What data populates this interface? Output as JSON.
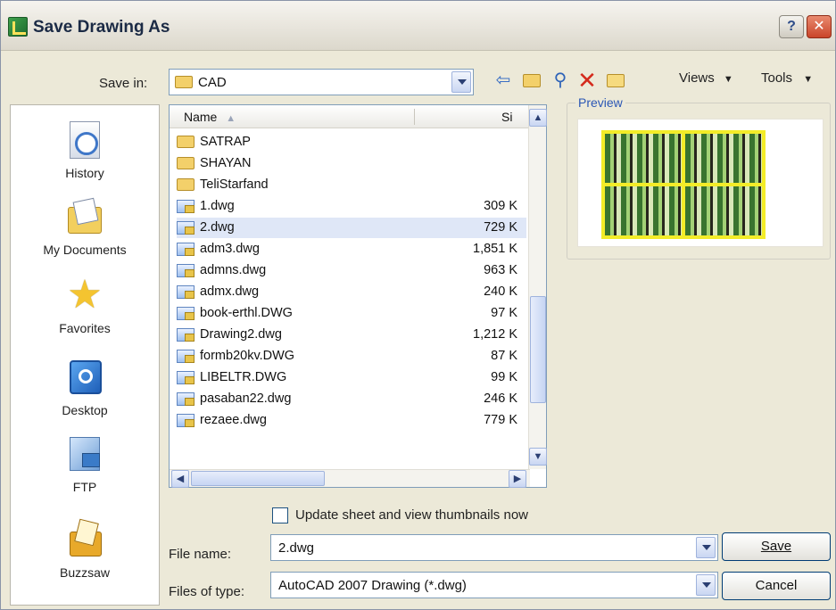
{
  "window": {
    "title": "Save Drawing As",
    "help_label": "?",
    "close_label": "✕"
  },
  "save_in": {
    "label": "Save in:",
    "value": "CAD"
  },
  "toolbar": {
    "back_icon": "back-arrow-icon",
    "up_icon": "up-folder-icon",
    "search_icon": "search-icon",
    "delete_icon": "delete-icon",
    "new_folder_icon": "new-folder-icon",
    "views_label": "Views",
    "tools_label": "Tools"
  },
  "places": [
    {
      "label": "History",
      "icon": "history-icon"
    },
    {
      "label": "My Documents",
      "icon": "my-documents-icon"
    },
    {
      "label": "Favorites",
      "icon": "favorites-icon"
    },
    {
      "label": "Desktop",
      "icon": "desktop-icon"
    },
    {
      "label": "FTP",
      "icon": "ftp-icon"
    },
    {
      "label": "Buzzsaw",
      "icon": "buzzsaw-icon"
    }
  ],
  "file_list": {
    "columns": {
      "name": "Name",
      "size": "Si"
    },
    "items": [
      {
        "name": "SATRAP",
        "type": "folder",
        "size": ""
      },
      {
        "name": "SHAYAN",
        "type": "folder",
        "size": ""
      },
      {
        "name": "TeliStarfand",
        "type": "folder",
        "size": ""
      },
      {
        "name": "1.dwg",
        "type": "dwg",
        "size": "309 K"
      },
      {
        "name": "2.dwg",
        "type": "dwg",
        "size": "729 K"
      },
      {
        "name": "adm3.dwg",
        "type": "dwg",
        "size": "1,851 K"
      },
      {
        "name": "admns.dwg",
        "type": "dwg",
        "size": "963 K"
      },
      {
        "name": "admx.dwg",
        "type": "dwg",
        "size": "240 K"
      },
      {
        "name": "book-erthl.DWG",
        "type": "dwg",
        "size": "97 K"
      },
      {
        "name": "Drawing2.dwg",
        "type": "dwg",
        "size": "1,212 K"
      },
      {
        "name": "formb20kv.DWG",
        "type": "dwg",
        "size": "87 K"
      },
      {
        "name": "LIBELTR.DWG",
        "type": "dwg",
        "size": "99 K"
      },
      {
        "name": "pasaban22.dwg",
        "type": "dwg",
        "size": "246 K"
      },
      {
        "name": "rezaee.dwg",
        "type": "dwg",
        "size": "779 K"
      }
    ]
  },
  "preview": {
    "label": "Preview"
  },
  "thumbnails_checkbox": {
    "label": "Update sheet and view thumbnails now",
    "checked": false
  },
  "file_name": {
    "label": "File name:",
    "value": "2.dwg"
  },
  "file_type": {
    "label": "Files of type:",
    "value": "AutoCAD 2007 Drawing (*.dwg)"
  },
  "buttons": {
    "save": "Save",
    "cancel": "Cancel"
  }
}
